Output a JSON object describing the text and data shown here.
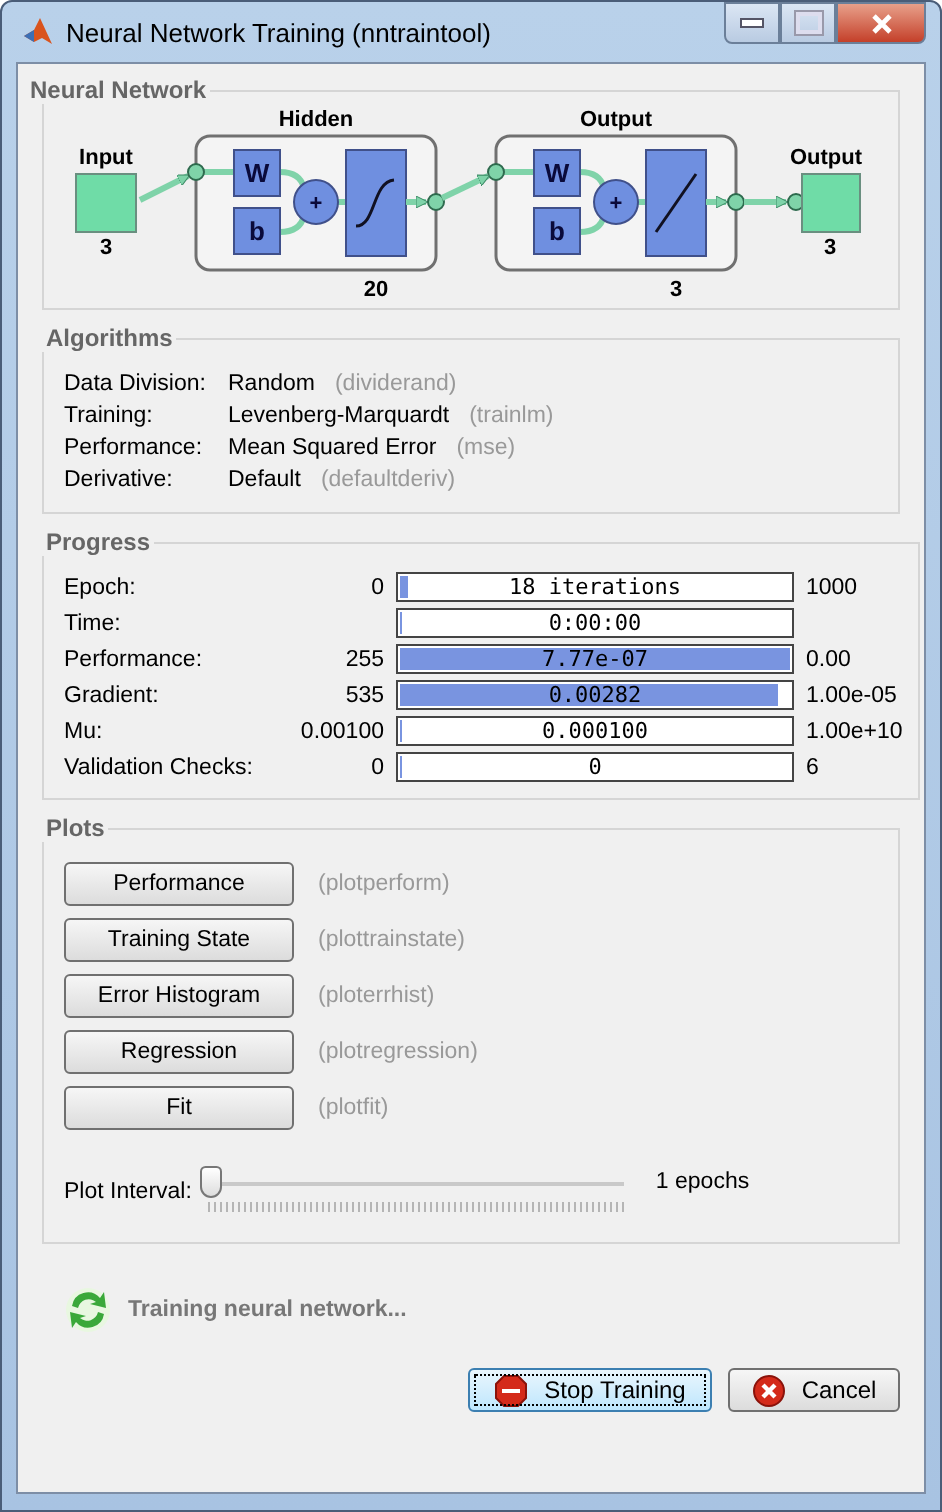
{
  "window": {
    "title": "Neural Network Training (nntraintool)"
  },
  "network": {
    "title": "Neural Network",
    "input": {
      "label": "Input",
      "size": "3"
    },
    "layers": [
      {
        "title": "Hidden",
        "weight": "W",
        "bias": "b",
        "sum": "+",
        "kind": "sigmoid",
        "size": "20"
      },
      {
        "title": "Output",
        "weight": "W",
        "bias": "b",
        "sum": "+",
        "kind": "linear",
        "size": "3"
      }
    ],
    "output": {
      "label": "Output",
      "size": "3"
    }
  },
  "algorithms": {
    "title": "Algorithms",
    "rows": [
      {
        "label": "Data Division:",
        "value": "Random",
        "function": "(dividerand)"
      },
      {
        "label": "Training:",
        "value": "Levenberg-Marquardt",
        "function": "(trainlm)"
      },
      {
        "label": "Performance:",
        "value": "Mean Squared Error",
        "function": "(mse)"
      },
      {
        "label": "Derivative:",
        "value": "Default",
        "function": "(defaultderiv)"
      }
    ]
  },
  "progress": {
    "title": "Progress",
    "rows": [
      {
        "label": "Epoch:",
        "start": "0",
        "value": "18 iterations",
        "end": "1000",
        "level": 0.018
      },
      {
        "label": "Time:",
        "value": "0:00:00",
        "level": 0
      },
      {
        "label": "Performance:",
        "start": "255",
        "value": "7.77e-07",
        "end": "0.00",
        "level": 0.99
      },
      {
        "label": "Gradient:",
        "start": "535",
        "value": "0.00282",
        "end": "1.00e-05",
        "level": 0.96
      },
      {
        "label": "Mu:",
        "start": "0.00100",
        "value": "0.000100",
        "end": "1.00e+10",
        "level": 0
      },
      {
        "label": "Validation Checks:",
        "start": "0",
        "value": "0",
        "end": "6",
        "level": 0
      }
    ]
  },
  "plots": {
    "title": "Plots",
    "buttons": [
      {
        "label": "Performance",
        "function": "(plotperform)"
      },
      {
        "label": "Training State",
        "function": "(plottrainstate)"
      },
      {
        "label": "Error Histogram",
        "function": "(ploterrhist)"
      },
      {
        "label": "Regression",
        "function": "(plotregression)"
      },
      {
        "label": "Fit",
        "function": "(plotfit)"
      }
    ],
    "interval": {
      "label": "Plot Interval:",
      "level": 0,
      "value": "1 epochs"
    }
  },
  "status": {
    "text": "Training neural network..."
  },
  "actions": [
    {
      "label": "Stop Training",
      "kind": "stop",
      "focused": true
    },
    {
      "label": "Cancel",
      "kind": "cancel",
      "focused": false
    }
  ]
}
